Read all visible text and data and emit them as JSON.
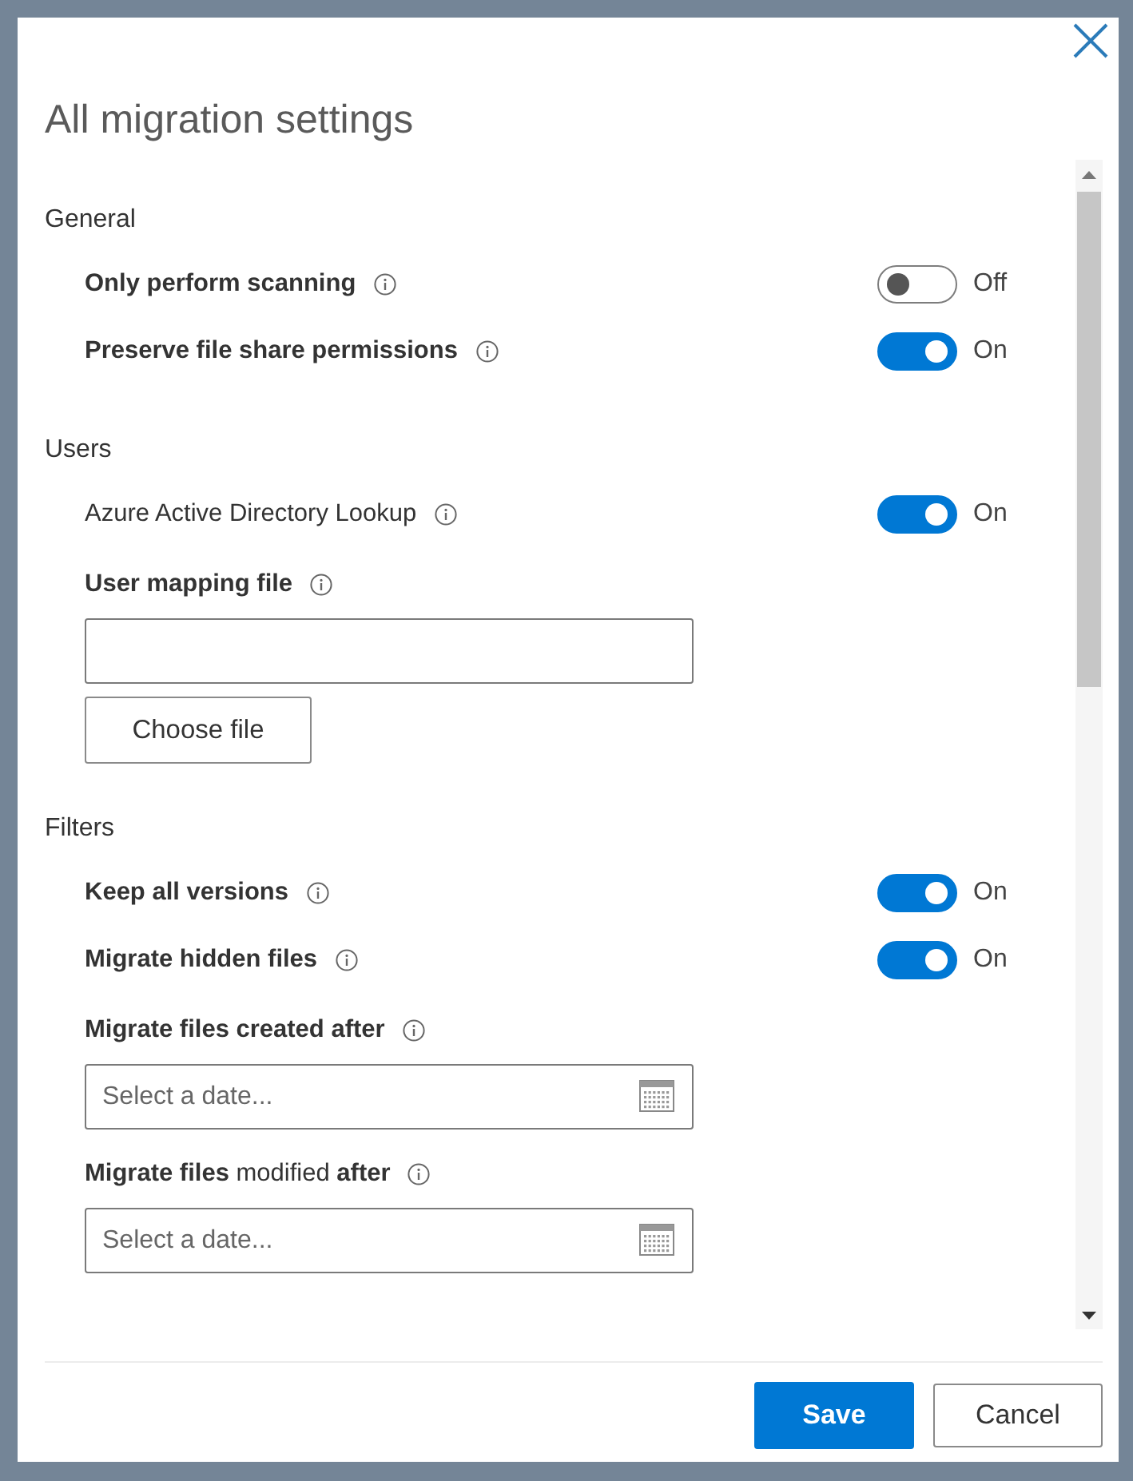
{
  "dialog": {
    "title": "All migration settings"
  },
  "sections": [
    {
      "heading": "General",
      "items": [
        {
          "kind": "toggle",
          "label": "Only perform scanning",
          "bold": true,
          "info": true,
          "on": false,
          "state_label": "Off"
        },
        {
          "kind": "toggle",
          "label": "Preserve file share permissions",
          "bold": true,
          "info": true,
          "on": true,
          "state_label": "On"
        }
      ]
    },
    {
      "heading": "Users",
      "items": [
        {
          "kind": "toggle",
          "label": "Azure Active Directory Lookup",
          "bold": false,
          "info": true,
          "on": true,
          "state_label": "On"
        },
        {
          "kind": "file",
          "label": "User mapping file",
          "bold": true,
          "info": true,
          "button": "Choose file"
        }
      ]
    },
    {
      "heading": "Filters",
      "items": [
        {
          "kind": "toggle",
          "label": "Keep all versions",
          "bold": true,
          "info": true,
          "on": true,
          "state_label": "On"
        },
        {
          "kind": "toggle",
          "label": "Migrate hidden files",
          "bold": true,
          "info": true,
          "on": true,
          "state_label": "On"
        },
        {
          "kind": "date",
          "label": "Migrate files created after",
          "bold": true,
          "info": true,
          "placeholder": "Select a date..."
        },
        {
          "kind": "date",
          "label": "**Migrate files** modified **after**",
          "bold": false,
          "info": true,
          "placeholder": "Select a date..."
        }
      ]
    }
  ],
  "footer": {
    "buttons": [
      {
        "kind": "primary",
        "label": "Save"
      },
      {
        "kind": "secondary",
        "label": "Cancel"
      }
    ]
  }
}
